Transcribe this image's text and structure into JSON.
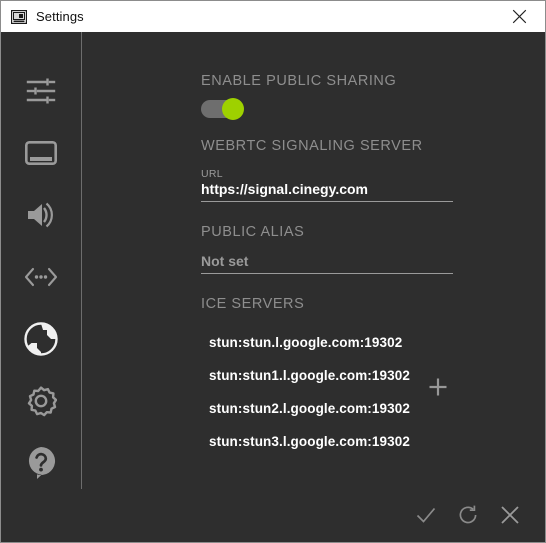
{
  "window": {
    "title": "Settings",
    "app_icon": "monitor-icon",
    "close_label": "close-icon"
  },
  "sidebar": {
    "items": [
      {
        "name": "sliders",
        "icon": "sliders-icon",
        "active": false
      },
      {
        "name": "screen",
        "icon": "monitor-icon",
        "active": false
      },
      {
        "name": "audio",
        "icon": "speaker-icon",
        "active": false
      },
      {
        "name": "api",
        "icon": "code-brackets-icon",
        "active": false
      },
      {
        "name": "network",
        "icon": "globe-icon",
        "active": true
      },
      {
        "name": "general",
        "icon": "gear-icon",
        "active": false
      },
      {
        "name": "help",
        "icon": "question-mark-icon",
        "active": false
      }
    ]
  },
  "main": {
    "sharing": {
      "heading": "ENABLE PUBLIC SHARING",
      "toggle_state": "on"
    },
    "signaling": {
      "heading": "WEBRTC SIGNALING SERVER",
      "url_label": "URL",
      "url_value": "https://signal.cinegy.com"
    },
    "alias": {
      "heading": "PUBLIC ALIAS",
      "value": "Not set"
    },
    "ice": {
      "heading": "ICE SERVERS",
      "servers": [
        "stun:stun.l.google.com:19302",
        "stun:stun1.l.google.com:19302",
        "stun:stun2.l.google.com:19302",
        "stun:stun3.l.google.com:19302"
      ],
      "add_label": "plus-icon"
    }
  },
  "footer": {
    "apply_label": "check-icon",
    "reset_label": "refresh-icon",
    "cancel_label": "close-icon"
  },
  "colors": {
    "background": "#2e2e2e",
    "titlebar": "#ffffff",
    "accent_green": "#9ed100",
    "heading": "#8e8e8e",
    "value": "#ffffff"
  }
}
